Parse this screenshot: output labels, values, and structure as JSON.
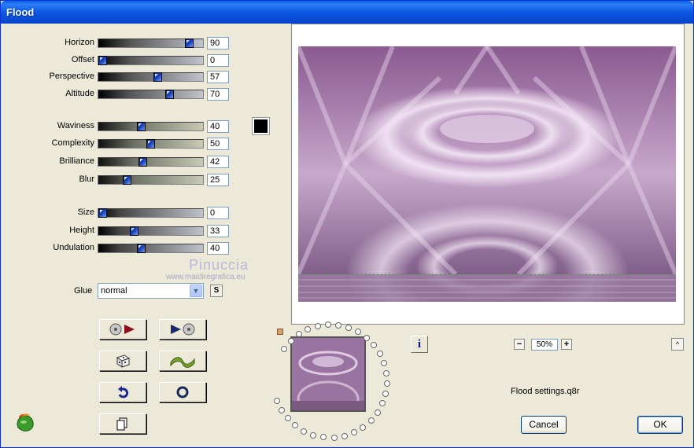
{
  "window": {
    "title": "Flood"
  },
  "sliders": [
    {
      "label": "Horizon",
      "value": "90",
      "level": 90
    },
    {
      "label": "Offset",
      "value": "0",
      "level": 0
    },
    {
      "label": "Perspective",
      "value": "57",
      "level": 57
    },
    {
      "label": "Altitude",
      "value": "70",
      "level": 70
    },
    {
      "label": "Waviness",
      "value": "40",
      "level": 40
    },
    {
      "label": "Complexity",
      "value": "50",
      "level": 50
    },
    {
      "label": "Brilliance",
      "value": "42",
      "level": 42
    },
    {
      "label": "Blur",
      "value": "25",
      "level": 25
    },
    {
      "label": "Size",
      "value": "0",
      "level": 0
    },
    {
      "label": "Height",
      "value": "33",
      "level": 33
    },
    {
      "label": "Undulation",
      "value": "40",
      "level": 40
    }
  ],
  "color_swatch": "#000000",
  "watermark": {
    "name": "Pinuccia",
    "url": "www.maidiregrafica.eu"
  },
  "glue": {
    "label": "Glue",
    "value": "normal",
    "s_button": "S"
  },
  "tool_buttons": [
    {
      "name": "load-preset-icon"
    },
    {
      "name": "play-icon"
    },
    {
      "name": "dice-icon"
    },
    {
      "name": "wave-icon"
    },
    {
      "name": "undo-icon"
    },
    {
      "name": "reset-icon"
    },
    {
      "name": "copy-icon"
    }
  ],
  "info_button": "i",
  "zoom": {
    "minus": "−",
    "value": "50%",
    "plus": "+"
  },
  "collapse_button": "^",
  "settings_file": "Flood settings.q8r",
  "buttons": {
    "cancel": "Cancel",
    "ok": "OK"
  },
  "colors": {
    "title_bar": "#0a5fe8",
    "background": "#ece9d8",
    "preview_purple": "#8a5a90"
  }
}
